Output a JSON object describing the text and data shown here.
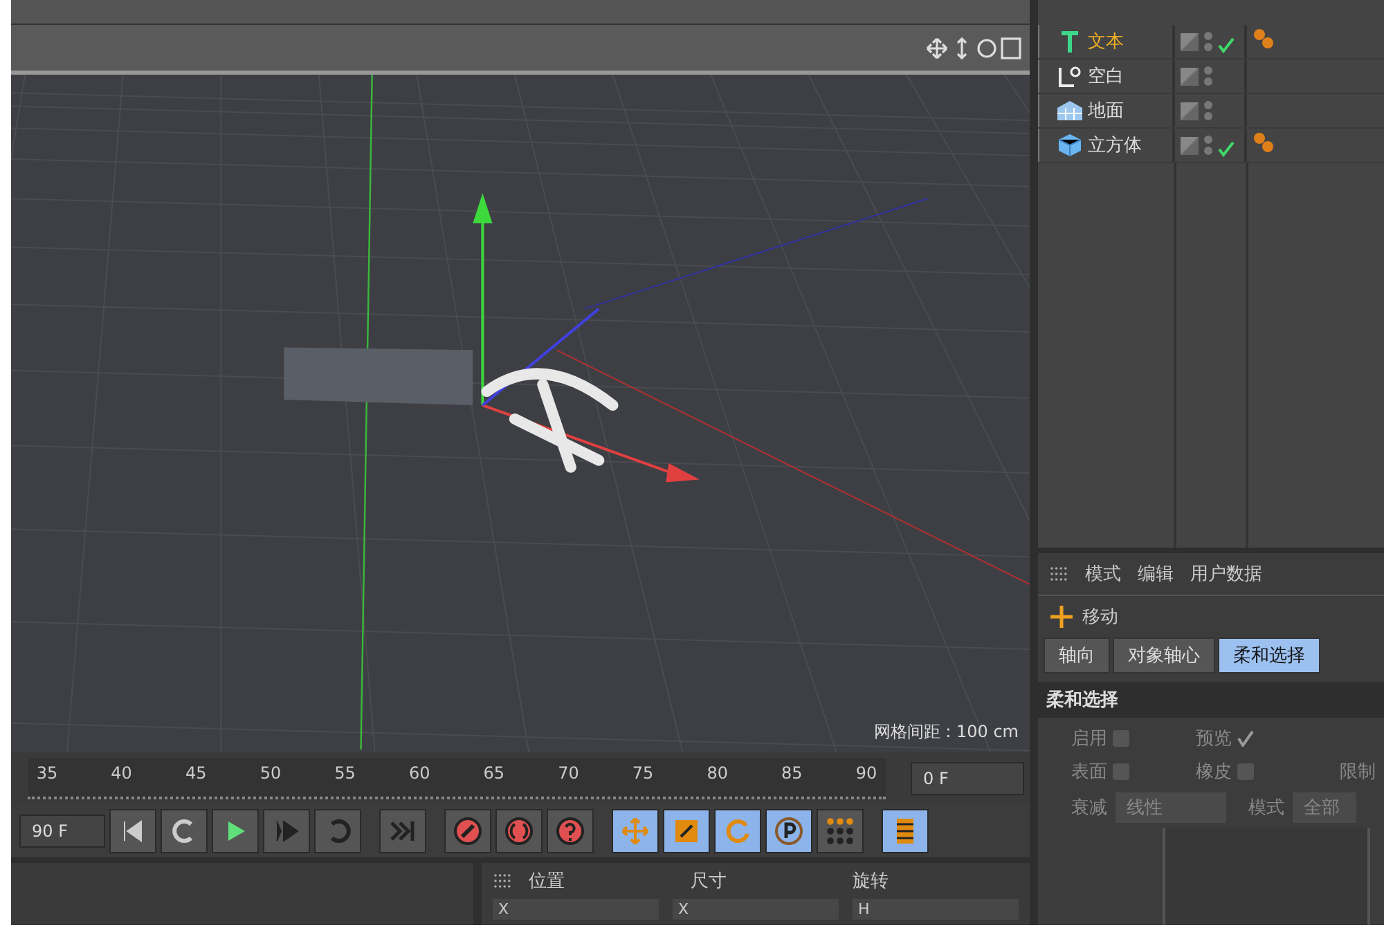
{
  "viewport": {
    "grid_label": "网格间距 : 100 cm"
  },
  "timeline": {
    "ticks": [
      "35",
      "40",
      "45",
      "50",
      "55",
      "60",
      "65",
      "70",
      "75",
      "80",
      "85",
      "90"
    ],
    "current_frame": "0 F",
    "end_frame": "90 F"
  },
  "transport": [
    {
      "kind": "prev",
      "on": false
    },
    {
      "kind": "back",
      "on": false
    },
    {
      "kind": "play",
      "on": false
    },
    {
      "kind": "next",
      "on": false
    },
    {
      "kind": "loop",
      "on": false
    },
    {
      "kind": "end",
      "on": false
    },
    {
      "kind": "record",
      "on": false
    },
    {
      "kind": "autokey",
      "on": false
    },
    {
      "kind": "keyhelp",
      "on": false
    },
    {
      "kind": "move",
      "on": true
    },
    {
      "kind": "scale",
      "on": true
    },
    {
      "kind": "rotate",
      "on": true
    },
    {
      "kind": "param",
      "on": true
    },
    {
      "kind": "points",
      "on": false
    },
    {
      "kind": "film",
      "on": true
    }
  ],
  "coords": {
    "headers": [
      "位置",
      "尺寸",
      "旋转"
    ],
    "axes": [
      "X",
      "X",
      "H"
    ]
  },
  "objects": [
    {
      "name": "文本",
      "kind": "text",
      "selected": true,
      "enabled": true,
      "tag": true
    },
    {
      "name": "空白",
      "kind": "null",
      "selected": false,
      "enabled": false,
      "tag": false
    },
    {
      "name": "地面",
      "kind": "floor",
      "selected": false,
      "enabled": false,
      "tag": false
    },
    {
      "name": "立方体",
      "kind": "cube",
      "selected": false,
      "enabled": true,
      "tag": true
    }
  ],
  "attributes": {
    "menu": [
      "模式",
      "编辑",
      "用户数据"
    ],
    "tool": "移动",
    "tabs": [
      {
        "label": "轴向",
        "selected": false
      },
      {
        "label": "对象轴心",
        "selected": false
      },
      {
        "label": "柔和选择",
        "selected": true
      }
    ],
    "section": "柔和选择",
    "options": [
      {
        "label": "启用",
        "checked": false
      },
      {
        "label": "预览",
        "checked": true
      },
      {
        "label": "表面",
        "checked": false
      },
      {
        "label": "橡皮",
        "checked": false
      }
    ],
    "limit_label": "限制",
    "falloff": {
      "label": "衰减",
      "value": "线性"
    },
    "mode": {
      "label": "模式",
      "value": "全部"
    }
  }
}
